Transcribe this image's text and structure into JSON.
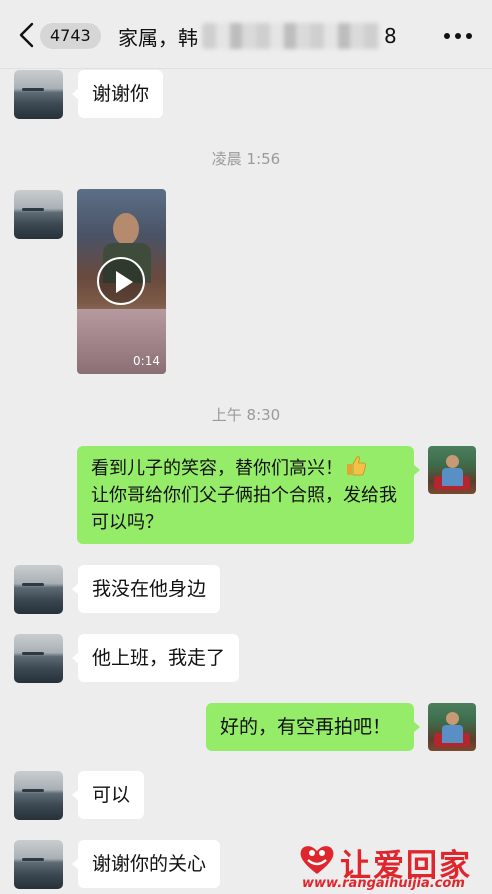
{
  "header": {
    "back_icon": "chevron-left-icon",
    "unread_count": "4743",
    "title_prefix": "家属，韩",
    "title_suffix": "8",
    "more_icon": "more-dots-icon"
  },
  "messages": {
    "m1": "谢谢你",
    "t1": "凌晨 1:56",
    "video_duration": "0:14",
    "t2": "上午 8:30",
    "m3_line1": "看到儿子的笑容，替你们高兴！",
    "m3_line2": "让你哥给你们父子俩拍个合照，发给我可以吗？",
    "m4": "我没在他身边",
    "m5": "他上班，我走了",
    "m6": "好的，有空再拍吧！",
    "m7": "可以",
    "m8": "谢谢你的关心"
  },
  "watermark": {
    "name": "让爱回家",
    "url": "www.rangaihuijia.com"
  },
  "colors": {
    "background": "#ededed",
    "incoming_bubble": "#ffffff",
    "outgoing_bubble": "#95ec69",
    "watermark_red": "#e0262d"
  }
}
